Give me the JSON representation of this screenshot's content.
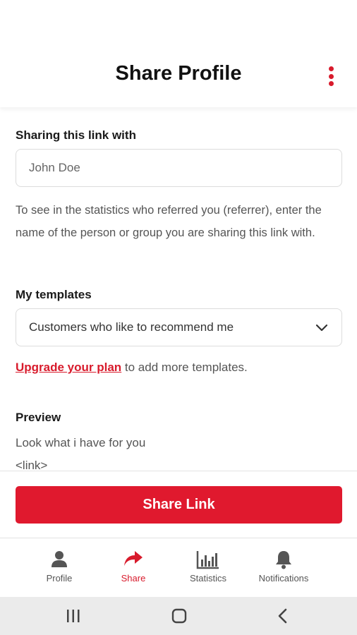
{
  "header": {
    "title": "Share Profile",
    "menu_icon": "more-vertical-icon",
    "accent_color": "#d81b2c"
  },
  "sharing": {
    "label": "Sharing this link with",
    "input_placeholder": "John Doe",
    "input_value": "",
    "help_text": "To see in the statistics who referred you (referrer), enter the name of the person or group you are sharing this link with."
  },
  "templates": {
    "label": "My templates",
    "selected": "Customers who like to recommend me",
    "upgrade_link": "Upgrade your plan",
    "upgrade_suffix": " to add more templates."
  },
  "preview": {
    "label": "Preview",
    "lines": [
      "Look what i have for you",
      "<link>"
    ]
  },
  "actions": {
    "share_label": "Share Link",
    "share_color": "#e0192e"
  },
  "bottom_nav": {
    "items": [
      {
        "label": "Profile",
        "icon": "person-icon",
        "active": false
      },
      {
        "label": "Share",
        "icon": "share-arrow-icon",
        "active": true
      },
      {
        "label": "Statistics",
        "icon": "bar-chart-icon",
        "active": false
      },
      {
        "label": "Notifications",
        "icon": "bell-icon",
        "active": false
      }
    ]
  },
  "system_nav": {
    "icons": [
      "recent-apps-icon",
      "home-icon",
      "back-icon"
    ]
  }
}
